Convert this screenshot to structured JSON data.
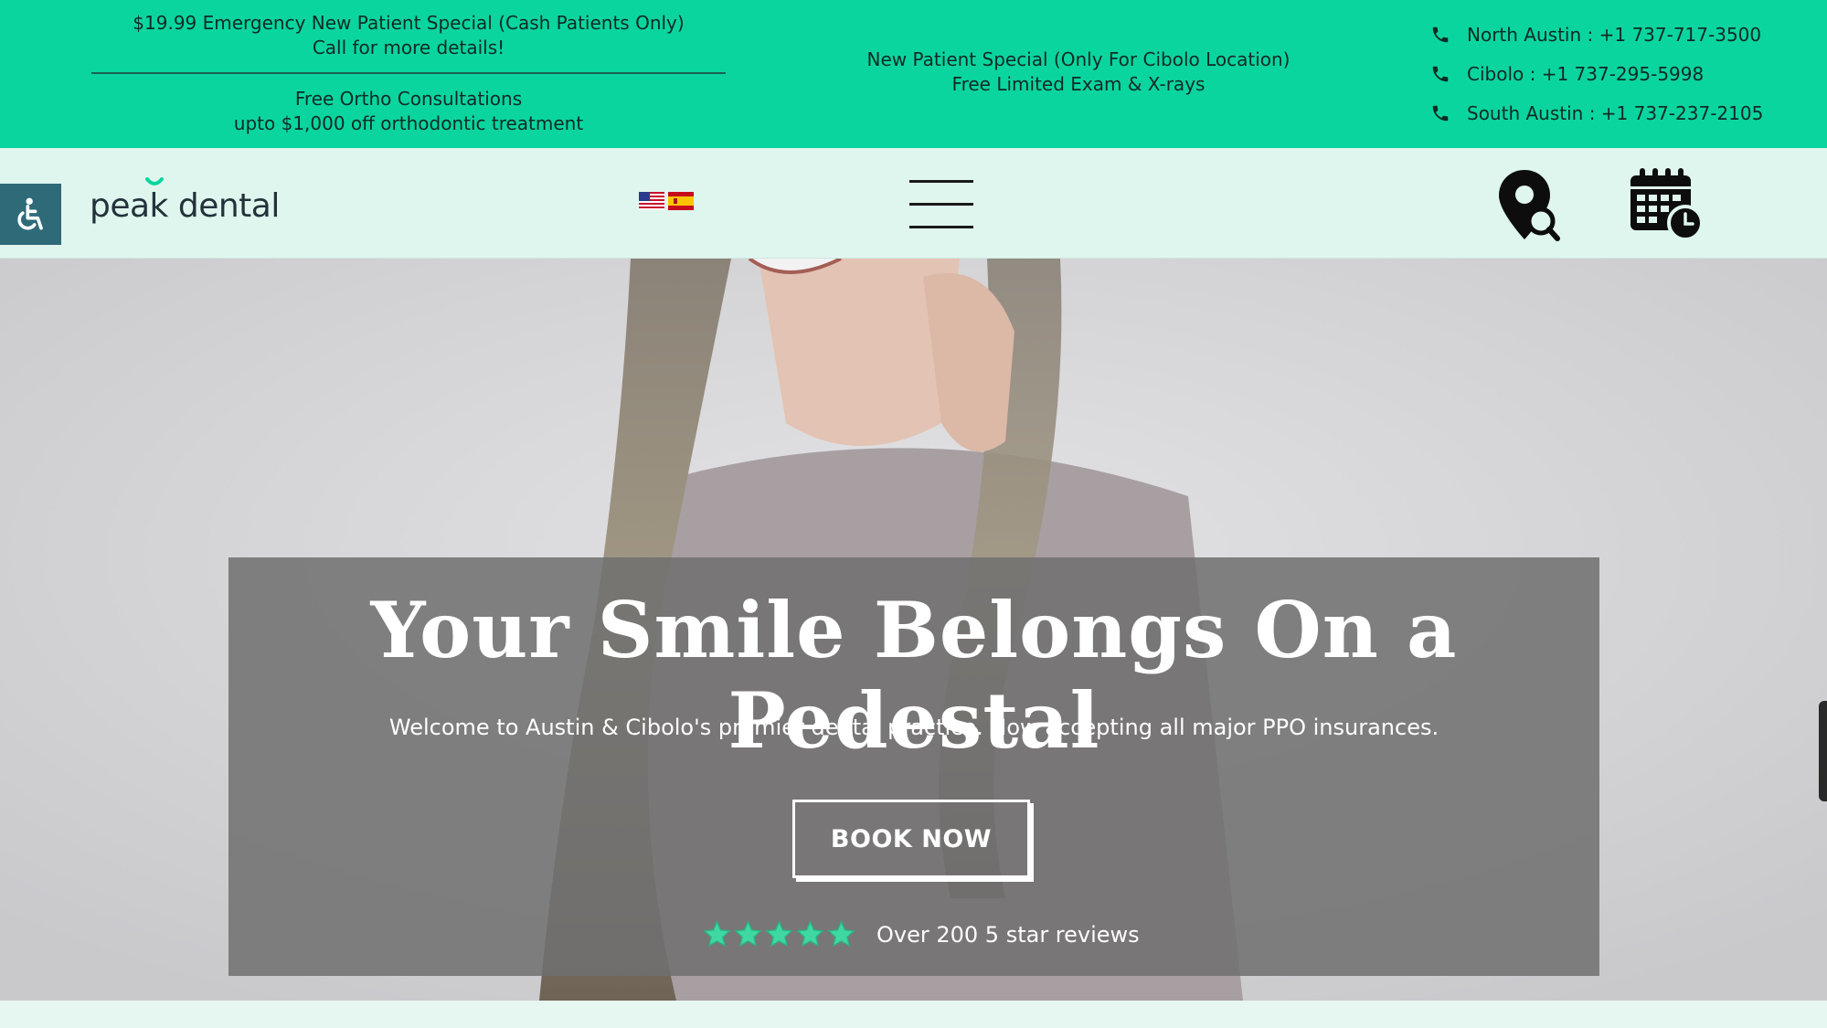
{
  "topbar": {
    "promo_left_1_line1": "$19.99 Emergency New Patient Special (Cash Patients Only)",
    "promo_left_1_line2": "Call for more details!",
    "promo_left_2_line1": "Free Ortho Consultations",
    "promo_left_2_line2": "upto $1,000 off orthodontic treatment",
    "promo_center_line1": "New Patient Special (Only For Cibolo Location)",
    "promo_center_line2": "Free Limited Exam & X-rays",
    "phones": [
      {
        "label": "North Austin : +1 737-717-3500",
        "icon": "phone-icon"
      },
      {
        "label": "Cibolo : +1 737-295-5998",
        "icon": "phone-icon"
      },
      {
        "label": "South Austin : +1 737-237-2105",
        "icon": "phone-icon"
      }
    ],
    "background_color": "#0bd59f"
  },
  "header": {
    "logo_text": "peak dental",
    "accessibility_icon": "wheelchair-icon",
    "language_flags": [
      "us-flag",
      "spain-flag"
    ],
    "menu_icon": "hamburger-menu-icon",
    "location_icon": "location-search-icon",
    "calendar_icon": "calendar-clock-icon",
    "background_color": "#dff6ee"
  },
  "hero": {
    "headline": "Your Smile Belongs On a Pedestal",
    "subheadline": "Welcome to Austin & Cibolo's premier dental practice. Now accepting all major PPO insurances.",
    "cta_label": "BOOK NOW",
    "rating_stars": 5,
    "reviews_text": "Over 200 5 star reviews",
    "star_color": "#3fd8a2"
  }
}
